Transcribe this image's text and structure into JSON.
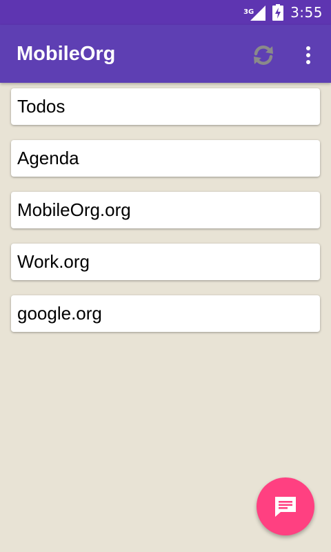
{
  "status_bar": {
    "network_type": "3G",
    "time": "3:55",
    "icons": [
      "signal-icon",
      "battery-charging-icon"
    ]
  },
  "app_bar": {
    "title": "MobileOrg",
    "actions": [
      "sync-icon",
      "more-vert-icon"
    ]
  },
  "files": [
    {
      "label": "Todos"
    },
    {
      "label": "Agenda"
    },
    {
      "label": "MobileOrg.org"
    },
    {
      "label": "Work.org"
    },
    {
      "label": "google.org"
    }
  ],
  "fab": {
    "icon": "message-icon"
  },
  "colors": {
    "status_bar": "#5e35b1",
    "app_bar": "#5e3fb3",
    "background": "#e8e3d5",
    "fab": "#ff4081",
    "card": "#ffffff"
  }
}
